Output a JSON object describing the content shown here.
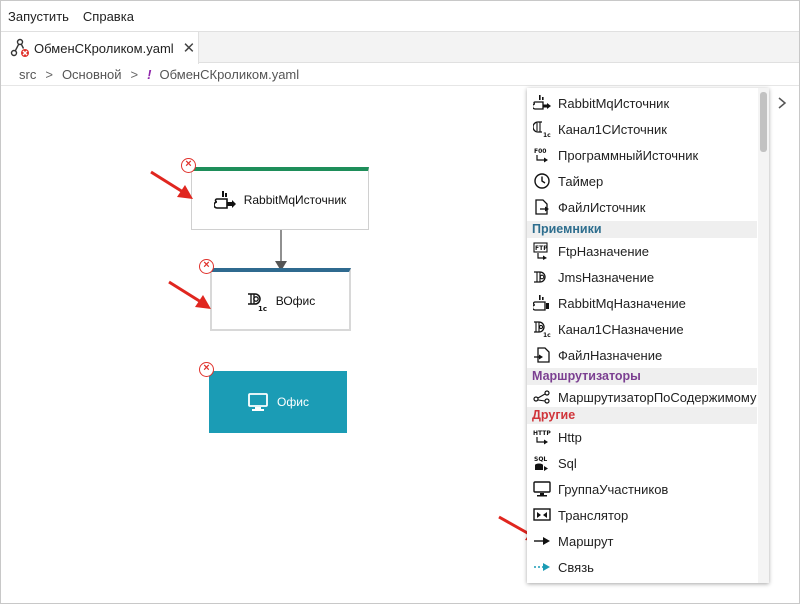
{
  "menu": {
    "items": [
      "Запустить",
      "Справка"
    ]
  },
  "tab": {
    "label": "ОбменСКроликом.yaml",
    "close": "✕"
  },
  "breadcrumb": {
    "items": [
      "src",
      "Основной"
    ],
    "file": "ОбменСКроликом.yaml",
    "file_marker": "!",
    "separator": ">"
  },
  "nodes": {
    "source": {
      "label": "RabbitMqИсточник",
      "accent": "#1e8e5a"
    },
    "dest": {
      "label": "ВОфис",
      "accent": "#2f6a8f"
    },
    "office": {
      "label": "Офис",
      "bg": "#1b9cb5"
    }
  },
  "palette": {
    "sources": [
      "RabbitMqИсточник",
      "Канал1СИсточник",
      "ПрограммныйИсточник",
      "Таймер",
      "ФайлИсточник"
    ],
    "receivers_header": "Приемники",
    "receivers": [
      "FtpНазначение",
      "JmsНазначение",
      "RabbitMqНазначение",
      "Канал1СНазначение",
      "ФайлНазначение"
    ],
    "routers_header": "Маршрутизаторы",
    "routers": [
      "МаршрутизаторПоСодержимому"
    ],
    "other_header": "Другие",
    "other": [
      "Http",
      "Sql",
      "ГруппаУчастников",
      "Транслятор",
      "Маршрут",
      "Связь"
    ]
  },
  "colors": {
    "receivers_header": "#2e6e8e",
    "routers_header": "#7b3f91",
    "other_header": "#d0343a",
    "annotation_arrow": "#e0261f",
    "remove_badge": "#e0322c"
  },
  "icons": {
    "tab": "flow-diagram-icon",
    "remove": "remove-circle-icon",
    "expand": "chevron-right-icon"
  }
}
